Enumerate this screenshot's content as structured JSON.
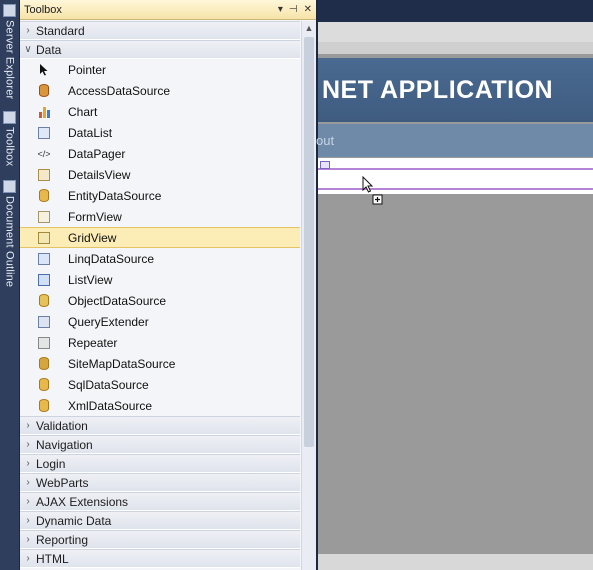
{
  "dock": {
    "tabs": [
      {
        "label": "Server Explorer",
        "icon": "server-icon"
      },
      {
        "label": "Toolbox",
        "icon": "toolbox-icon"
      },
      {
        "label": "Document Outline",
        "icon": "outline-icon"
      }
    ]
  },
  "toolbox": {
    "title": "Toolbox",
    "buttons": {
      "dropdown": "▾",
      "pin": "⊣",
      "close": "✕"
    },
    "groups_before": [
      {
        "label": "Standard",
        "expanded": false
      }
    ],
    "data_group": {
      "label": "Data",
      "expanded": true,
      "items": [
        {
          "label": "Pointer",
          "icon": "pointer-icon"
        },
        {
          "label": "AccessDataSource",
          "icon": "access-datasource-icon"
        },
        {
          "label": "Chart",
          "icon": "chart-icon"
        },
        {
          "label": "DataList",
          "icon": "datalist-icon"
        },
        {
          "label": "DataPager",
          "icon": "datapager-icon"
        },
        {
          "label": "DetailsView",
          "icon": "detailsview-icon"
        },
        {
          "label": "EntityDataSource",
          "icon": "entity-datasource-icon"
        },
        {
          "label": "FormView",
          "icon": "formview-icon"
        },
        {
          "label": "GridView",
          "icon": "gridview-icon",
          "selected": true
        },
        {
          "label": "LinqDataSource",
          "icon": "linq-datasource-icon"
        },
        {
          "label": "ListView",
          "icon": "listview-icon"
        },
        {
          "label": "ObjectDataSource",
          "icon": "object-datasource-icon"
        },
        {
          "label": "QueryExtender",
          "icon": "queryextender-icon"
        },
        {
          "label": "Repeater",
          "icon": "repeater-icon"
        },
        {
          "label": "SiteMapDataSource",
          "icon": "sitemap-datasource-icon"
        },
        {
          "label": "SqlDataSource",
          "icon": "sql-datasource-icon"
        },
        {
          "label": "XmlDataSource",
          "icon": "xml-datasource-icon"
        }
      ]
    },
    "groups_after": [
      {
        "label": "Validation"
      },
      {
        "label": "Navigation"
      },
      {
        "label": "Login"
      },
      {
        "label": "WebParts"
      },
      {
        "label": "AJAX Extensions"
      },
      {
        "label": "Dynamic Data"
      },
      {
        "label": "Reporting"
      },
      {
        "label": "HTML"
      }
    ]
  },
  "designer": {
    "header_title": "NET APPLICATION",
    "nav_item": "out"
  },
  "colors": {
    "selected_bg": "#fcecb6",
    "header_blue": "#4a6a91",
    "nav_blue": "#6f8aa8",
    "accent_purple": "#b684d6"
  }
}
